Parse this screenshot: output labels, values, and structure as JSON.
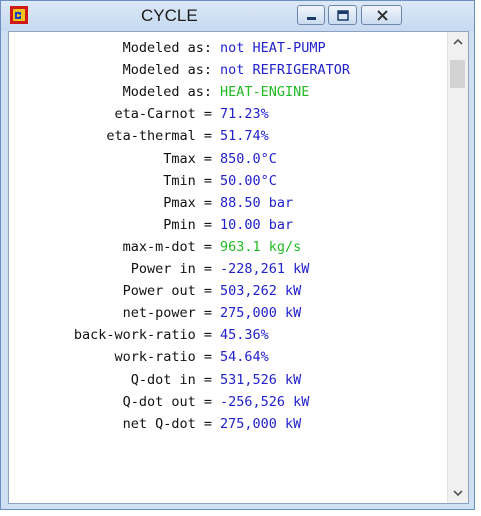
{
  "window": {
    "title": "CYCLE",
    "icon": "app-cycle-icon"
  },
  "controls": {
    "minimize_icon": "minimize-icon",
    "maximize_icon": "maximize-icon",
    "close_icon": "close-icon"
  },
  "lines": [
    {
      "label": "Modeled as:",
      "value": "not HEAT-PUMP",
      "color": "#2222cc"
    },
    {
      "label": "Modeled as:",
      "value": "not REFRIGERATOR",
      "color": "#2222cc"
    },
    {
      "label": "Modeled as:",
      "value": "HEAT-ENGINE",
      "color": "#22bb22"
    },
    {
      "label": "eta-Carnot =",
      "value": "71.23%",
      "color": "#2222cc"
    },
    {
      "label": "eta-thermal =",
      "value": "51.74%",
      "color": "#2222cc"
    },
    {
      "label": "Tmax =",
      "value": "850.0°C",
      "color": "#2222cc"
    },
    {
      "label": "Tmin =",
      "value": "50.00°C",
      "color": "#2222cc"
    },
    {
      "label": "Pmax =",
      "value": "88.50 bar",
      "color": "#2222cc"
    },
    {
      "label": "Pmin =",
      "value": "10.00 bar",
      "color": "#2222cc"
    },
    {
      "label": "max-m-dot =",
      "value": "963.1 kg/s",
      "color": "#22bb22"
    },
    {
      "label": "Power in =",
      "value": "-228,261 kW",
      "color": "#2222cc"
    },
    {
      "label": "Power out =",
      "value": "503,262 kW",
      "color": "#2222cc"
    },
    {
      "label": "net-power =",
      "value": "275,000 kW",
      "color": "#2222cc"
    },
    {
      "label": "back-work-ratio =",
      "value": "45.36%",
      "color": "#2222cc"
    },
    {
      "label": "work-ratio =",
      "value": "54.64%",
      "color": "#2222cc"
    },
    {
      "label": "Q-dot in =",
      "value": "531,526 kW",
      "color": "#2222cc"
    },
    {
      "label": "Q-dot out =",
      "value": "-256,526 kW",
      "color": "#2222cc"
    },
    {
      "label": "net Q-dot =",
      "value": "275,000 kW",
      "color": "#2222cc"
    }
  ],
  "scrollbar": {
    "up_icon": "chevron-up-icon",
    "down_icon": "chevron-down-icon"
  }
}
